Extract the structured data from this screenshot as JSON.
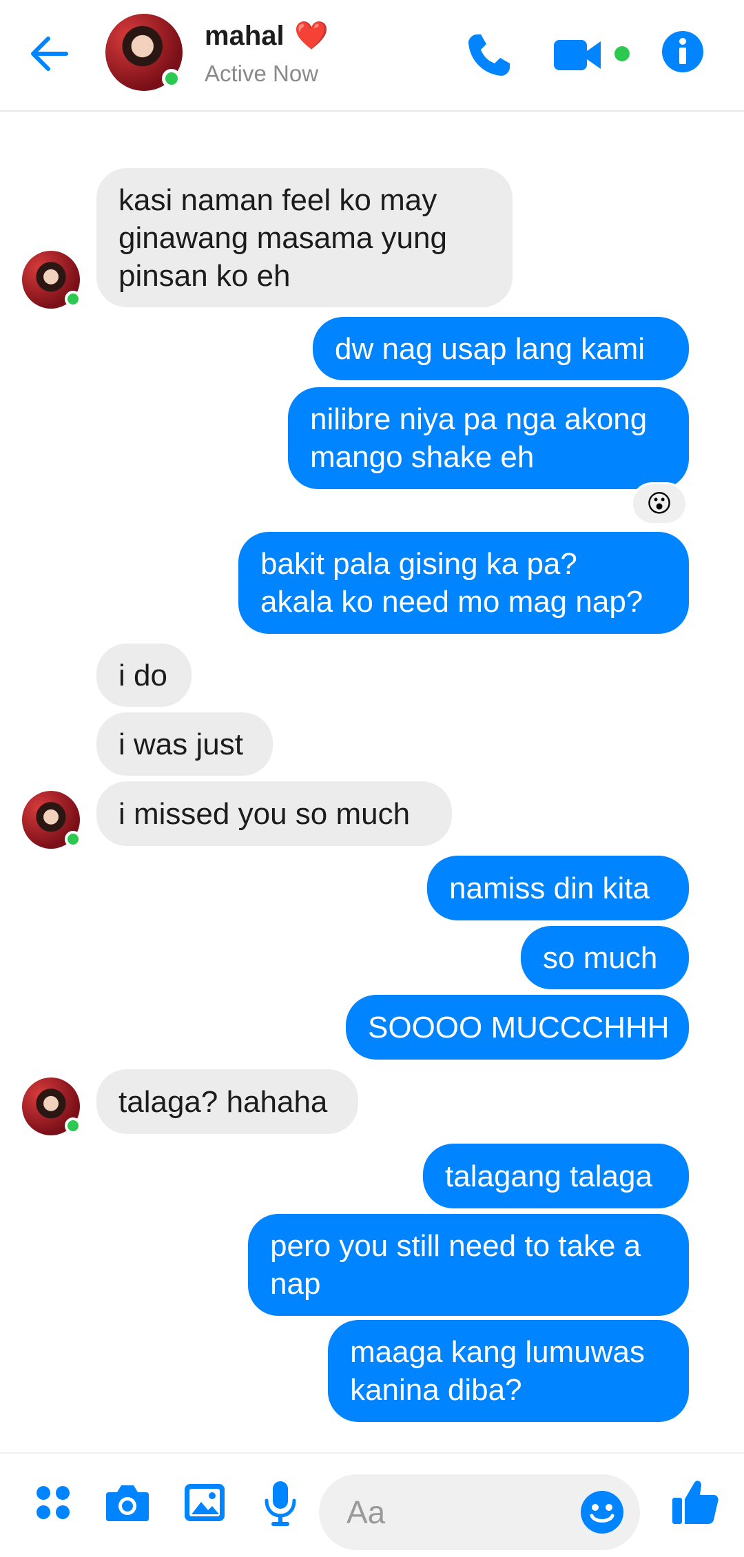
{
  "header": {
    "contact_name": "mahal",
    "contact_emoji": "❤️",
    "status": "Active Now",
    "icons": [
      "back-arrow-icon",
      "phone-icon",
      "video-camera-icon",
      "info-icon"
    ]
  },
  "messages": [
    {
      "from": "them",
      "lines": [
        "kasi naman feel ko may",
        "ginawang masama yung",
        "pinsan ko eh"
      ]
    },
    {
      "from": "me",
      "lines": [
        "dw nag usap lang kami"
      ]
    },
    {
      "from": "me",
      "lines": [
        "nilibre niya pa nga akong",
        "mango shake eh"
      ],
      "reaction": "😮"
    },
    {
      "from": "me",
      "lines": [
        "bakit pala gising ka pa?",
        "akala ko need mo mag nap?"
      ]
    },
    {
      "from": "them",
      "lines": [
        "i do"
      ]
    },
    {
      "from": "them",
      "lines": [
        "i was just"
      ]
    },
    {
      "from": "them",
      "lines": [
        "i missed you so much"
      ]
    },
    {
      "from": "me",
      "lines": [
        "namiss din kita"
      ]
    },
    {
      "from": "me",
      "lines": [
        "so much"
      ]
    },
    {
      "from": "me",
      "lines": [
        "SOOOO MUCCCHHH"
      ]
    },
    {
      "from": "them",
      "lines": [
        "talaga? hahaha"
      ]
    },
    {
      "from": "me",
      "lines": [
        "talagang talaga"
      ]
    },
    {
      "from": "me",
      "lines": [
        "pero you still need to take a",
        "nap"
      ]
    },
    {
      "from": "me",
      "lines": [
        "maaga kang lumuwas",
        "kanina diba?"
      ]
    }
  ],
  "composer": {
    "placeholder": "Aa",
    "icons": [
      "apps-icon",
      "camera-icon",
      "gallery-icon",
      "microphone-icon",
      "emoji-icon",
      "thumbs-up-icon"
    ]
  },
  "colors": {
    "accent": "#0084ff",
    "incoming_bubble": "#ececec",
    "online": "#2bc94f"
  }
}
